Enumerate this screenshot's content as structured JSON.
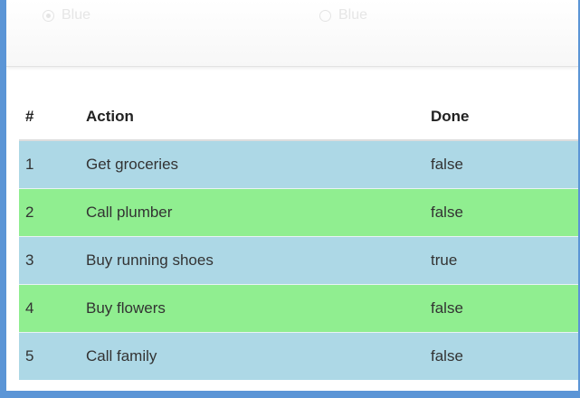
{
  "filter_options": [
    {
      "label": "Blue",
      "checked": true
    },
    {
      "label": "Blue",
      "checked": false
    }
  ],
  "table": {
    "headers": [
      "#",
      "Action",
      "Done"
    ],
    "rows": [
      {
        "num": "1",
        "action": "Get groceries",
        "done": "false",
        "color": "#add8e6"
      },
      {
        "num": "2",
        "action": "Call plumber",
        "done": "false",
        "color": "#90ee90"
      },
      {
        "num": "3",
        "action": "Buy running shoes",
        "done": "true",
        "color": "#add8e6"
      },
      {
        "num": "4",
        "action": "Buy flowers",
        "done": "false",
        "color": "#90ee90"
      },
      {
        "num": "5",
        "action": "Call family",
        "done": "false",
        "color": "#add8e6"
      }
    ]
  },
  "colors": {
    "window_border": "#5b95d6",
    "row_blue": "#add8e6",
    "row_green": "#90ee90"
  }
}
